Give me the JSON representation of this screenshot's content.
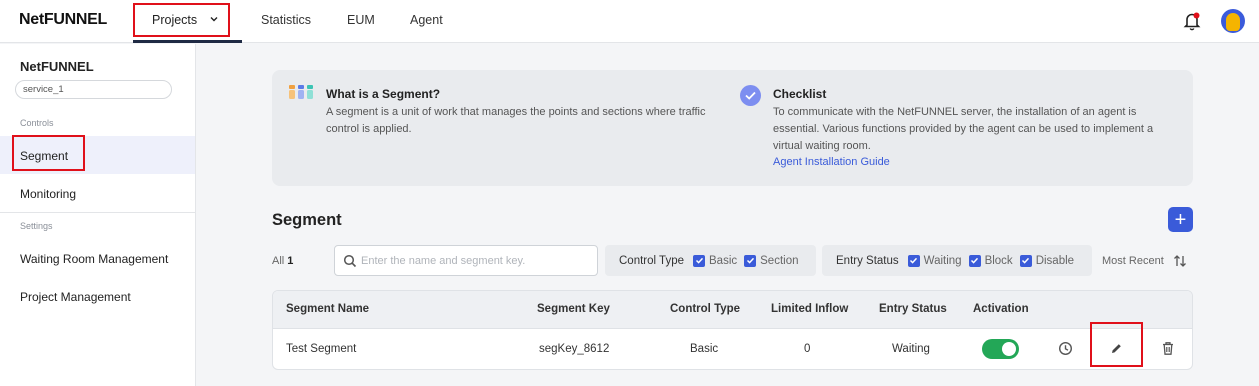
{
  "topnav": {
    "logo": "NetFUNNEL",
    "projects_label": "Projects",
    "items": [
      {
        "label": "Statistics"
      },
      {
        "label": "EUM"
      },
      {
        "label": "Agent"
      }
    ]
  },
  "sidebar": {
    "title": "NetFUNNEL",
    "service_select": "service_1",
    "controls_section": "Controls",
    "settings_section": "Settings",
    "items": {
      "segment": "Segment",
      "monitoring": "Monitoring",
      "waiting_room": "Waiting Room Management",
      "project_mgmt": "Project Management"
    }
  },
  "info": {
    "segment_heading": "What is a Segment?",
    "segment_text_1": "A segment is a unit of work that manages the points and sections where traffic",
    "segment_text_2": "control is applied.",
    "checklist_heading": "Checklist",
    "checklist_text_1": "To communicate with the NetFUNNEL server, the installation of an agent is",
    "checklist_text_2": "essential. Various functions provided by the agent can be used to implement a",
    "checklist_text_3": "virtual waiting room.",
    "guide_link": "Agent Installation Guide"
  },
  "main": {
    "title": "Segment",
    "add_button": "+",
    "all_label": "All",
    "all_count": "1",
    "search_placeholder": "Enter the name and segment key.",
    "control_type_label": "Control Type",
    "control_types": [
      "Basic",
      "Section"
    ],
    "entry_status_label": "Entry Status",
    "entry_statuses": [
      "Waiting",
      "Block",
      "Disable"
    ],
    "sort_label": "Most Recent"
  },
  "table": {
    "headers": [
      "Segment Name",
      "Segment Key",
      "Control Type",
      "Limited Inflow",
      "Entry Status",
      "Activation"
    ],
    "rows": [
      {
        "name": "Test Segment",
        "key": "segKey_8612",
        "control_type": "Basic",
        "limited_inflow": "0",
        "entry_status": "Waiting",
        "activation": true
      }
    ]
  },
  "colors": {
    "accent": "#3a5bd9",
    "highlight_box": "#e0101a",
    "toggle_on": "#23a757",
    "nav_underline": "#1f2a44"
  }
}
